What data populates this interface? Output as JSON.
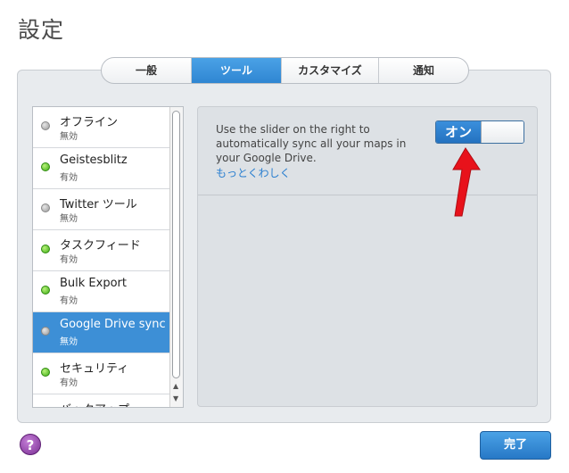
{
  "window": {
    "title": "設定"
  },
  "tabs": [
    {
      "label": "一般",
      "active": false
    },
    {
      "label": "ツール",
      "active": true
    },
    {
      "label": "カスタマイズ",
      "active": false
    },
    {
      "label": "通知",
      "active": false
    }
  ],
  "tools": [
    {
      "name": "オフライン",
      "status": "無効",
      "enabled": false
    },
    {
      "name": "Geistesblitz",
      "status": "有効",
      "enabled": true
    },
    {
      "name": "Twitter ツール",
      "status": "無効",
      "enabled": false
    },
    {
      "name": "タスクフィード",
      "status": "有効",
      "enabled": true
    },
    {
      "name": "Bulk Export",
      "status": "有効",
      "enabled": true
    },
    {
      "name": "Google Drive sync",
      "status": "無効",
      "enabled": false,
      "selected": true
    },
    {
      "name": "セキュリティ",
      "status": "有効",
      "enabled": true
    },
    {
      "name": "バックアップ",
      "status": "",
      "enabled": false
    }
  ],
  "detail": {
    "description": "Use the slider on the right to automatically sync all your maps in your Google Drive.",
    "more_link": "もっとくわしく",
    "toggle_label": "オン"
  },
  "footer": {
    "help_label": "?",
    "done_label": "完了"
  },
  "colors": {
    "accent": "#3d8fd6",
    "annotation": "#e8121b"
  }
}
